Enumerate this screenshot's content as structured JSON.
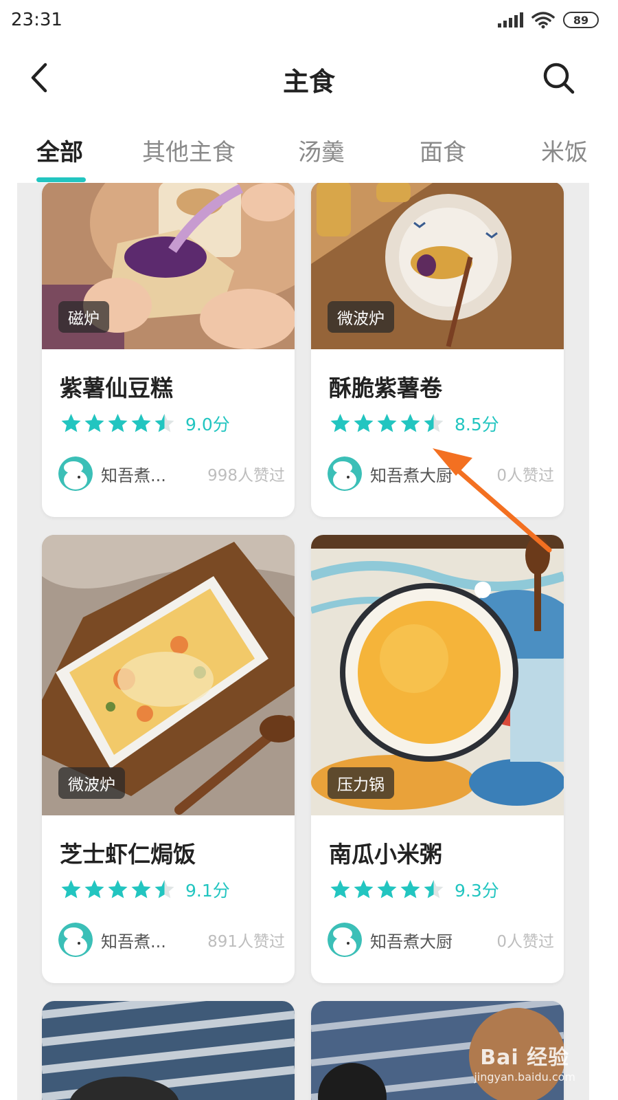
{
  "status_bar": {
    "time": "23:31",
    "battery": "89"
  },
  "header": {
    "title": "主食"
  },
  "tabs": [
    {
      "label": "全部",
      "active": true
    },
    {
      "label": "其他主食",
      "active": false
    },
    {
      "label": "汤羹",
      "active": false
    },
    {
      "label": "面食",
      "active": false
    },
    {
      "label": "米饭",
      "active": false
    }
  ],
  "recipes": [
    {
      "badge": "磁炉",
      "title": "紫薯仙豆糕",
      "rating": 4.5,
      "score": "9.0分",
      "author": "知吾煮...",
      "likes": "998人赞过"
    },
    {
      "badge": "微波炉",
      "title": "酥脆紫薯卷",
      "rating": 4.5,
      "score": "8.5分",
      "author": "知吾煮大厨",
      "likes": "0人赞过"
    },
    {
      "badge": "微波炉",
      "title": "芝士虾仁焗饭",
      "rating": 4.5,
      "score": "9.1分",
      "author": "知吾煮...",
      "likes": "891人赞过"
    },
    {
      "badge": "压力锅",
      "title": "南瓜小米粥",
      "rating": 4.5,
      "score": "9.3分",
      "author": "知吾煮大厨",
      "likes": "0人赞过"
    }
  ],
  "watermark": {
    "main": "Bai 经验",
    "sub": "jingyan.baidu.com"
  },
  "colors": {
    "accent": "#22c5c0",
    "arrow": "#f37021"
  }
}
